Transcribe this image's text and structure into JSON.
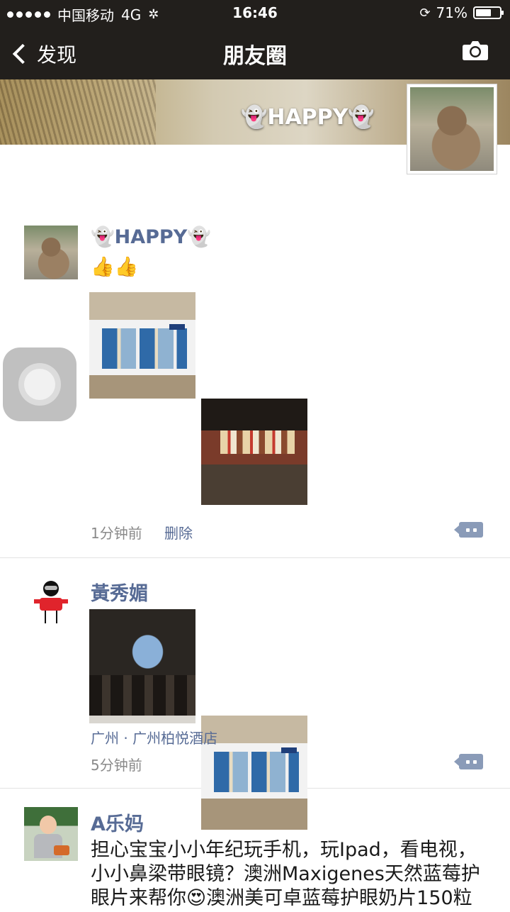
{
  "status_bar": {
    "carrier": "中国移动",
    "network": "4G",
    "time": "16:46",
    "battery_text": "71%",
    "battery_level": 0.71
  },
  "nav": {
    "back_label": "发现",
    "title": "朋友圈",
    "camera_icon": "camera-icon"
  },
  "cover": {
    "name": "👻HAPPY👻"
  },
  "posts": [
    {
      "user": "👻HAPPY👻",
      "text": "👍👍",
      "time": "1分钟前",
      "delete_label": "删除"
    },
    {
      "user": "黃秀媚",
      "location": "广州 · 广州柏悦酒店",
      "time": "5分钟前"
    },
    {
      "user": "A乐妈",
      "lines": [
        "担心宝宝小小年纪玩手机，玩Ipad，看电视，",
        "小小鼻梁带眼镜？澳洲Maxigenes天然蓝莓护",
        "眼片来帮你😍澳洲美可卓蓝莓护眼奶片150粒"
      ]
    }
  ],
  "colors": {
    "header_bg": "#221f1c",
    "link_blue": "#576b95",
    "meta_gray": "#8a8a8a"
  }
}
